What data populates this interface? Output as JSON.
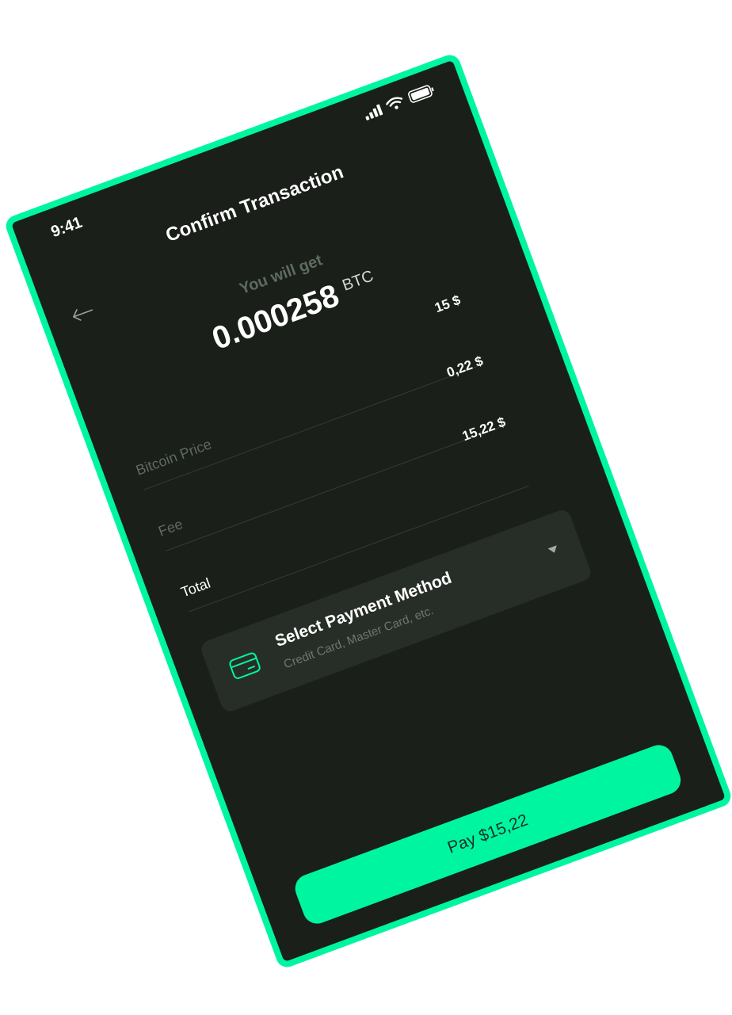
{
  "status_bar": {
    "time": "9:41"
  },
  "header": {
    "title": "Confirm Transaction"
  },
  "receive": {
    "caption": "You will get",
    "amount": "0.000258",
    "unit": "BTC"
  },
  "summary": {
    "rows": [
      {
        "label": "Bitcoin Price",
        "value": "15 $"
      },
      {
        "label": "Fee",
        "value": "0,22 $"
      },
      {
        "label": "Total",
        "value": "15,22 $"
      }
    ]
  },
  "payment": {
    "title": "Select Payment Method",
    "subtitle": "Credit Card, Master Card, etc."
  },
  "actions": {
    "pay_label": "Pay $15,22"
  },
  "colors": {
    "accent": "#00f5a0",
    "background": "#1a1f19",
    "card": "#272e27"
  }
}
